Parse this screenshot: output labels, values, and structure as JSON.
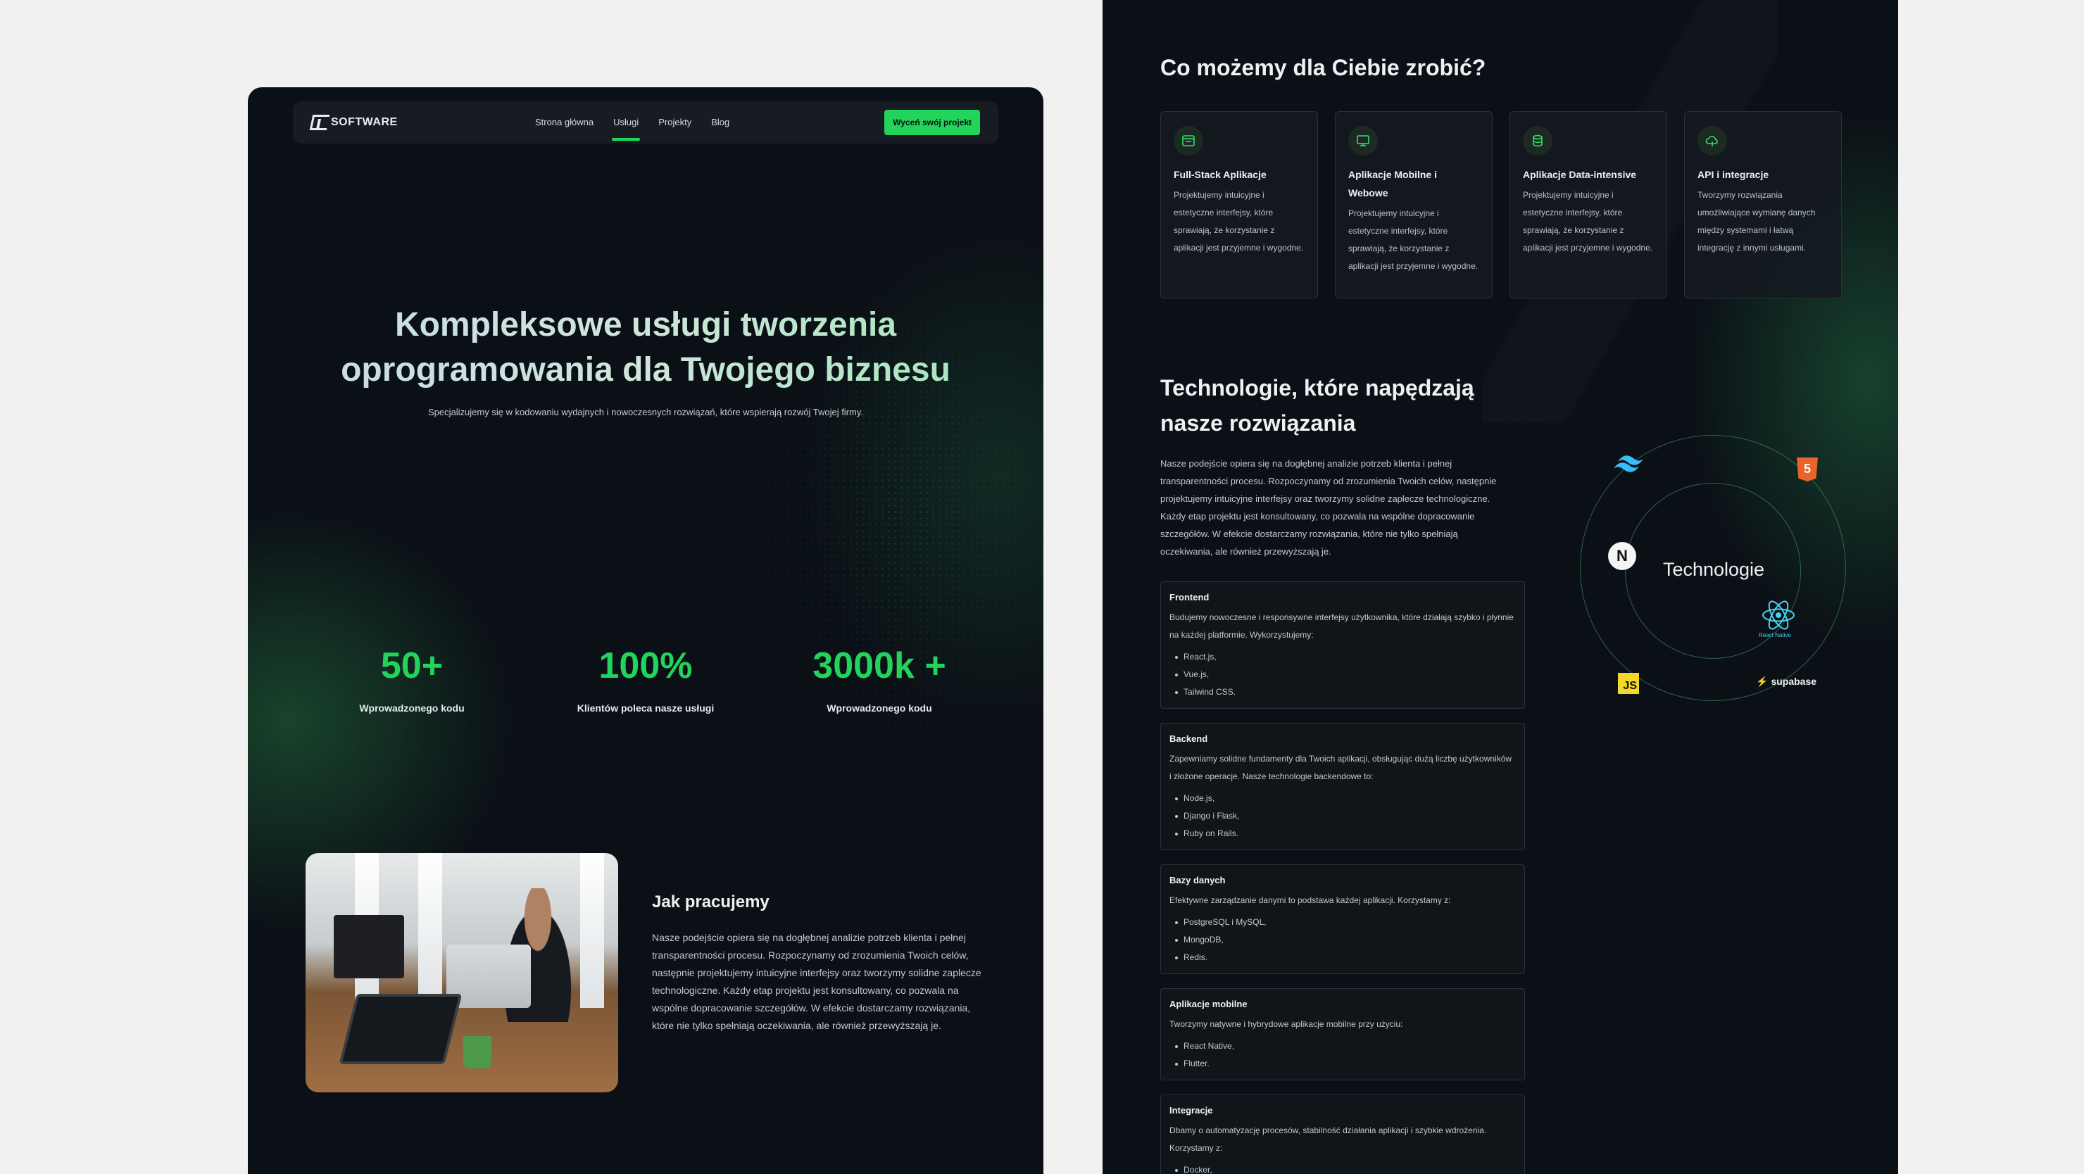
{
  "left_page": {
    "nav": {
      "logo_text": "SOFTWARE",
      "links": [
        "Strona główna",
        "Usługi",
        "Projekty",
        "Blog"
      ],
      "active_link": "Usługi",
      "cta_label": "Wyceń swój projekt"
    },
    "hero": {
      "title_line1": "Kompleksowe usługi tworzenia",
      "title_line2": "oprogramowania dla Twojego biznesu",
      "subtitle": "Specjalizujemy się w kodowaniu wydajnych i nowoczesnych rozwiązań, które wspierają rozwój Twojej firmy."
    },
    "stats": [
      {
        "value": "50+",
        "label": "Wprowadzonego kodu"
      },
      {
        "value": "100%",
        "label": "Klientów poleca nasze usługi"
      },
      {
        "value": "3000k +",
        "label": "Wprowadzonego kodu"
      }
    ],
    "how_we_work": {
      "title": "Jak pracujemy",
      "text": "Nasze podejście opiera się na dogłębnej analizie potrzeb klienta i pełnej transparentności procesu. Rozpoczynamy od zrozumienia Twoich celów, następnie projektujemy intuicyjne interfejsy oraz tworzymy solidne zaplecze technologiczne. Każdy etap projektu jest konsultowany, co pozwala na wspólne dopracowanie szczegółów. W efekcie dostarczamy rozwiązania, które nie tylko spełniają oczekiwania, ale również przewyższają je."
    }
  },
  "right_page": {
    "services_title": "Co możemy dla Ciebie zrobić?",
    "services": [
      {
        "icon": "layout-icon",
        "title": "Full-Stack Aplikacje",
        "text": "Projektujemy intuicyjne i estetyczne interfejsy, które sprawiają, że korzystanie z aplikacji jest przyjemne i wygodne."
      },
      {
        "icon": "monitor-icon",
        "title": "Aplikacje Mobilne i Webowe",
        "text": "Projektujemy intuicyjne i estetyczne interfejsy, które sprawiają, że korzystanie z aplikacji jest przyjemne i wygodne."
      },
      {
        "icon": "data-icon",
        "title": "Aplikacje Data-intensive",
        "text": "Projektujemy intuicyjne i estetyczne interfejsy, które sprawiają, że korzystanie z aplikacji jest przyjemne i wygodne."
      },
      {
        "icon": "api-cloud-icon",
        "title": "API i integracje",
        "text": "Tworzymy rozwiązania umożliwiające wymianę danych między systemami i łatwą integrację z innymi usługami."
      }
    ],
    "tech": {
      "title_line1": "Technologie, które napędzają",
      "title_line2": "nasze rozwiązania",
      "text": "Nasze podejście opiera się na dogłębnej analizie potrzeb klienta i pełnej transparentności procesu. Rozpoczynamy od zrozumienia Twoich celów, następnie projektujemy intuicyjne interfejsy oraz tworzymy solidne zaplecze technologiczne. Każdy etap projektu jest konsultowany, co pozwala na wspólne dopracowanie szczegółów. W efekcie dostarczamy rozwiązania, które nie tylko spełniają oczekiwania, ale również przewyższają je.",
      "orbit_label": "Technologie",
      "orbit_icons": {
        "html": "5",
        "next": "N",
        "js": "JS",
        "react": "React Native",
        "supabase": "supabase"
      }
    },
    "categories": [
      {
        "title": "Frontend",
        "desc": "Budujemy nowoczesne i responsywne interfejsy użytkownika, które działają szybko i płynnie na każdej platformie. Wykorzystujemy:",
        "items": [
          "React.js,",
          "Vue.js,",
          "Tailwind CSS."
        ]
      },
      {
        "title": "Backend",
        "desc": "Zapewniamy solidne fundamenty dla Twoich aplikacji, obsługując dużą liczbę użytkowników i złożone operacje. Nasze technologie backendowe to:",
        "items": [
          "Node.js,",
          "Django i Flask,",
          "Ruby on Rails."
        ]
      },
      {
        "title": "Bazy danych",
        "desc": "Efektywne zarządzanie danymi to podstawa każdej aplikacji. Korzystamy z:",
        "items": [
          "PostgreSQL i MySQL,",
          "MongoDB,",
          "Redis."
        ]
      },
      {
        "title": "Aplikacje mobilne",
        "desc": "Tworzymy natywne i hybrydowe aplikacje mobilne przy użyciu:",
        "items": [
          "React Native,",
          "Flutter."
        ]
      },
      {
        "title": "Integracje",
        "desc": "Dbamy o automatyzację procesów, stabilność działania aplikacji i szybkie wdrożenia. Korzystamy z:",
        "items": [
          "Docker,"
        ]
      }
    ]
  },
  "colors": {
    "accent": "#22d35c",
    "bg": "#0b1016",
    "page_bg": "#f1f1f1"
  }
}
